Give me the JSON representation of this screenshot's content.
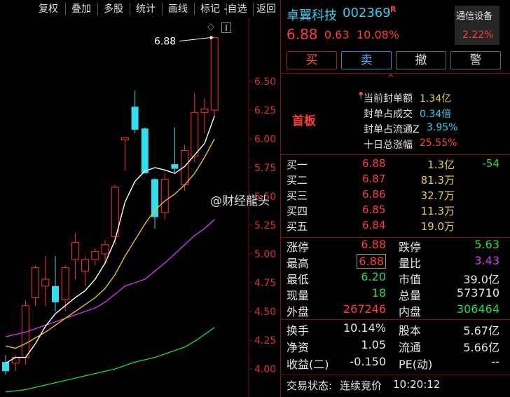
{
  "toolbar": {
    "items": [
      "复权",
      "叠加",
      "多股",
      "统计",
      "画线",
      "标记",
      "-自选",
      "返回"
    ]
  },
  "stock": {
    "name": "卓翼科技",
    "code": "002369",
    "tag": "R",
    "price": "6.88",
    "change": "0.63",
    "change_pct": "10.08%",
    "sector": "通信设备",
    "sector_pct": "2.22%"
  },
  "trade_buttons": {
    "buy": "买",
    "sell": "卖",
    "cancel": "撤",
    "alert": "警"
  },
  "seal": {
    "badge": "首板",
    "collapse": "^",
    "rows": [
      {
        "label": "当前封单额",
        "value": "1.34亿",
        "color": "yellow"
      },
      {
        "label": "封单占成交",
        "value": "0.34倍",
        "color": "cyan"
      },
      {
        "label": "封单占流通Z",
        "value": "3.95%",
        "color": "cyan"
      },
      {
        "label": "十日总涨幅",
        "value": "25.55%",
        "color": "red"
      }
    ]
  },
  "order_book": [
    {
      "label": "买一",
      "price": "6.88",
      "volume": "1.3亿",
      "delta": "-54"
    },
    {
      "label": "买二",
      "price": "6.87",
      "volume": "81.3万",
      "delta": ""
    },
    {
      "label": "买三",
      "price": "6.86",
      "volume": "32.7万",
      "delta": ""
    },
    {
      "label": "买四",
      "price": "6.85",
      "volume": "11.3万",
      "delta": ""
    },
    {
      "label": "买五",
      "price": "6.84",
      "volume": "19.0万",
      "delta": ""
    }
  ],
  "watermark": "@财经龍头",
  "quote": [
    {
      "l1": "涨停",
      "v1": "6.88",
      "c1": "red",
      "l2": "跌停",
      "v2": "5.63",
      "c2": "green"
    },
    {
      "l1": "最高",
      "v1": "6.88",
      "c1": "red",
      "l2": "量比",
      "v2": "3.43",
      "c2": "purple"
    },
    {
      "l1": "最低",
      "v1": "6.20",
      "c1": "green",
      "l2": "市值",
      "v2": "39.0亿",
      "c2": "white"
    },
    {
      "l1": "现量",
      "v1": "18",
      "c1": "green",
      "l2": "总量",
      "v2": "573710",
      "c2": "white"
    },
    {
      "l1": "外盘",
      "v1": "267246",
      "c1": "red",
      "l2": "内盘",
      "v2": "306464",
      "c2": "green"
    }
  ],
  "fundamentals": [
    {
      "l1": "换手",
      "v1": "10.14%",
      "l2": "股本",
      "v2": "5.67亿"
    },
    {
      "l1": "净资",
      "v1": "1.05",
      "l2": "流通",
      "v2": "5.66亿"
    },
    {
      "l1": "收益(二)",
      "v1": "-0.150",
      "l2": "PE(动)",
      "v2": "--"
    }
  ],
  "status": {
    "label": "交易状态:",
    "value": "连续竞价",
    "time": "10:20:12"
  },
  "chart_data": {
    "type": "candlestick",
    "y_ticks": [
      "6.50",
      "6.25",
      "6.00",
      "5.75",
      "5.50",
      "5.25",
      "5.00",
      "4.75",
      "4.50",
      "4.25",
      "4.00"
    ],
    "ylim": [
      3.75,
      6.95
    ],
    "high_label": "6.88",
    "candles": [
      {
        "o": 4.06,
        "h": 4.12,
        "l": 3.95,
        "c": 3.98
      },
      {
        "o": 4.05,
        "h": 4.12,
        "l": 3.98,
        "c": 4.1
      },
      {
        "o": 4.1,
        "h": 4.6,
        "l": 4.04,
        "c": 4.55
      },
      {
        "o": 4.62,
        "h": 4.9,
        "l": 4.55,
        "c": 4.88
      },
      {
        "o": 4.72,
        "h": 4.98,
        "l": 4.55,
        "c": 4.78
      },
      {
        "o": 4.72,
        "h": 4.98,
        "l": 4.5,
        "c": 4.58
      },
      {
        "o": 4.6,
        "h": 4.9,
        "l": 4.5,
        "c": 4.88
      },
      {
        "o": 4.95,
        "h": 5.18,
        "l": 4.78,
        "c": 5.1
      },
      {
        "o": 4.85,
        "h": 4.98,
        "l": 4.72,
        "c": 4.95
      },
      {
        "o": 4.95,
        "h": 5.05,
        "l": 4.9,
        "c": 5.02
      },
      {
        "o": 5.0,
        "h": 5.12,
        "l": 4.92,
        "c": 5.08
      },
      {
        "o": 5.15,
        "h": 5.6,
        "l": 5.08,
        "c": 5.58
      },
      {
        "o": 5.99,
        "h": 6.01,
        "l": 5.72,
        "c": 6.01
      },
      {
        "o": 6.28,
        "h": 6.42,
        "l": 6.05,
        "c": 6.08
      },
      {
        "o": 6.09,
        "h": 6.1,
        "l": 5.7,
        "c": 5.7
      },
      {
        "o": 5.65,
        "h": 5.66,
        "l": 5.22,
        "c": 5.32
      },
      {
        "o": 5.36,
        "h": 5.7,
        "l": 5.3,
        "c": 5.65
      },
      {
        "o": 5.78,
        "h": 6.1,
        "l": 5.7,
        "c": 5.74
      },
      {
        "o": 5.6,
        "h": 5.95,
        "l": 5.55,
        "c": 5.9
      },
      {
        "o": 5.85,
        "h": 6.4,
        "l": 5.8,
        "c": 6.23
      },
      {
        "o": 6.23,
        "h": 6.35,
        "l": 6.05,
        "c": 6.26
      },
      {
        "o": 6.25,
        "h": 6.88,
        "l": 6.2,
        "c": 6.88
      }
    ],
    "ma_white": [
      4.05,
      4.1,
      4.1,
      4.22,
      4.37,
      4.48,
      4.55,
      4.62,
      4.68,
      4.78,
      4.92,
      5.12,
      5.45,
      5.63,
      5.72,
      5.75,
      5.73,
      5.7,
      5.76,
      5.86,
      5.96,
      6.2
    ],
    "ma_yellow": [
      4.2,
      4.18,
      4.22,
      4.27,
      4.32,
      4.38,
      4.44,
      4.5,
      4.56,
      4.62,
      4.7,
      4.82,
      4.98,
      5.12,
      5.26,
      5.38,
      5.46,
      5.52,
      5.6,
      5.7,
      5.84,
      6.0
    ],
    "ma_purple": [
      4.28,
      4.3,
      4.32,
      4.35,
      4.38,
      4.41,
      4.44,
      4.47,
      4.5,
      4.53,
      4.58,
      4.65,
      4.72,
      4.75,
      4.78,
      4.85,
      4.92,
      5.0,
      5.08,
      5.16,
      5.22,
      5.3
    ],
    "ma_green": [
      3.8,
      3.81,
      3.82,
      3.84,
      3.86,
      3.88,
      3.9,
      3.92,
      3.94,
      3.96,
      3.98,
      4.0,
      4.03,
      4.06,
      4.08,
      4.1,
      4.13,
      4.16,
      4.19,
      4.24,
      4.3,
      4.36
    ]
  }
}
